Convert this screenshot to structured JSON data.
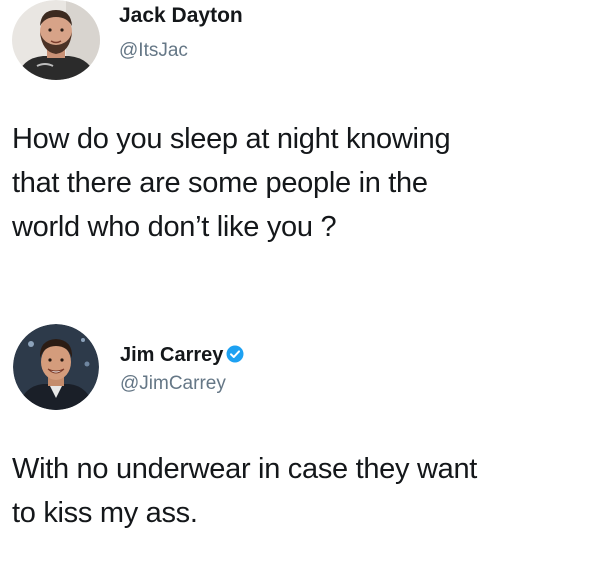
{
  "tweets": [
    {
      "author": {
        "name": "Jack Dayton",
        "handle": "@ItsJac",
        "verified": false,
        "avatar_icon": "bearded-man-avatar-icon"
      },
      "text": "How do you sleep at night knowing\nthat there are some people in the\nworld who don’t like you ?"
    },
    {
      "author": {
        "name": "Jim Carrey",
        "handle": "@JimCarrey",
        "verified": true,
        "verified_icon": "verified-badge-icon",
        "avatar_icon": "smiling-man-avatar-icon"
      },
      "text": "With no underwear in case they want\nto kiss my ass."
    }
  ],
  "colors": {
    "name": "#14171a",
    "handle": "#657786",
    "verified": "#1da1f2",
    "background": "#ffffff"
  }
}
